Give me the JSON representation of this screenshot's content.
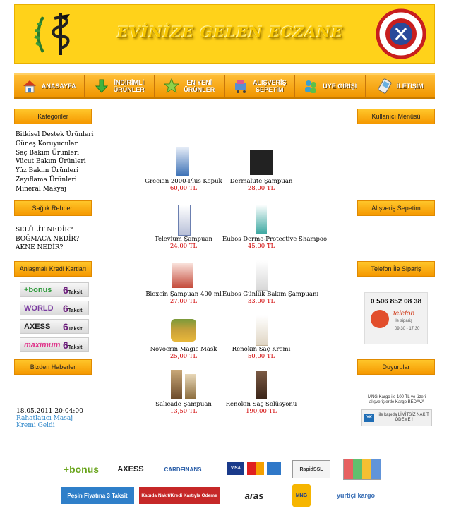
{
  "banner": {
    "title": "EVİNİZE GELEN ECZANE"
  },
  "nav": [
    {
      "label": "ANASAYFA",
      "icon": "home-icon"
    },
    {
      "label": "İNDİRİMLİ\nÜRÜNLER",
      "icon": "down-arrow-icon"
    },
    {
      "label": "EN YENİ\nÜRÜNLER",
      "icon": "star-icon"
    },
    {
      "label": "ALIŞVERİŞ\nSEPETİM",
      "icon": "cart-icon"
    },
    {
      "label": "ÜYE GİRİŞİ",
      "icon": "users-icon"
    },
    {
      "label": "İLETİŞİM",
      "icon": "phone-icon"
    }
  ],
  "left": {
    "categories_title": "Kategoriler",
    "categories": [
      "Bitkisel Destek Ürünleri",
      "Güneş Koruyucular",
      "Saç Bakım Ürünleri",
      "Vücut Bakım Ürünleri",
      "Yüz Bakım Ürünleri",
      "Zayıflama Ürünleri",
      "Mineral Makyaj"
    ],
    "guide_title": "Sağlık Rehberi",
    "guide": [
      "SELÜLİT NEDİR?",
      "BOĞMACA NEDİR?",
      "AKNE NEDİR?"
    ],
    "cards_title": "Anlaşmalı Kredi Kartları",
    "cards": [
      {
        "brand": "+bonus",
        "taksit_num": "6",
        "taksit": "Taksit",
        "color": "#2e9b3b"
      },
      {
        "brand": "WORLD",
        "taksit_num": "6",
        "taksit": "Taksit",
        "color": "#7a3aa0"
      },
      {
        "brand": "AXESS",
        "taksit_num": "6",
        "taksit": "Taksit",
        "color": "#222222"
      },
      {
        "brand": "maximum",
        "taksit_num": "6",
        "taksit": "Taksit",
        "color": "#e0348a"
      }
    ],
    "news_title": "Bizden Haberler",
    "news_date": "18.05.2011 20:04:00",
    "news_link": "Rahatlatıcı Masaj Kremi Geldi"
  },
  "right": {
    "user_menu": "Kullanıcı Menüsü",
    "cart": "Alışveriş Sepetim",
    "phone_title": "Telefon İle Sipariş",
    "phone_number": "0 506 852 08 38",
    "phone_word": "telefon",
    "phone_sub": "ile sipariş",
    "phone_hours": "09.30 - 17.30",
    "announcements": "Duyurular",
    "promo_text": "MNG Kargo ile 100 TL ve üzeri alışverişlerde Kargo BEDAVA",
    "promo_strip": "ile kapıda LİMİTSİZ NAKİT ÖDEME !"
  },
  "products": [
    {
      "name": "Grecian 2000-Plus Kopuk",
      "price": "60,00 TL",
      "color": "#3a6fb5"
    },
    {
      "name": "Dermalute Şampuan",
      "price": "28,00 TL",
      "color": "#222222"
    },
    {
      "name": "Televium Şampuan",
      "price": "24,00 TL",
      "color": "#6b7fb0"
    },
    {
      "name": "Eubos Dermo-Protective Shampoo",
      "price": "45,00 TL",
      "color": "#3aa7a0"
    },
    {
      "name": "Bioxcin Şampuan 400 ml",
      "price": "27,00 TL",
      "color": "#c44a3a"
    },
    {
      "name": "Eubos Günlük Bakım Şampuanı",
      "price": "33,00 TL",
      "color": "#e8e8e8"
    },
    {
      "name": "Novocrin Magic Mask",
      "price": "25,00 TL",
      "color": "#c9a13a"
    },
    {
      "name": "Renokin Saç Kremi",
      "price": "50,00 TL",
      "color": "#e0d6c4"
    },
    {
      "name": "Salicade Şampuan",
      "price": "13,50 TL",
      "color": "#6b4a2a"
    },
    {
      "name": "Renokin Saç Solüsyonu",
      "price": "190,00 TL",
      "color": "#3a2418"
    }
  ],
  "footer": {
    "bonus": "+bonus",
    "axess": "AXESS",
    "cardfinans": "CARDFINANS",
    "visa": "VISA",
    "rapidssl": "RapidSSL",
    "pesin": "Peşin Fiyatına 3 Taksit",
    "kapida": "Kapıda Nakit/Kredi Kartıyla Ödeme",
    "aras": "aras",
    "mng": "MNG",
    "yurtici": "yurtiçi kargo"
  }
}
